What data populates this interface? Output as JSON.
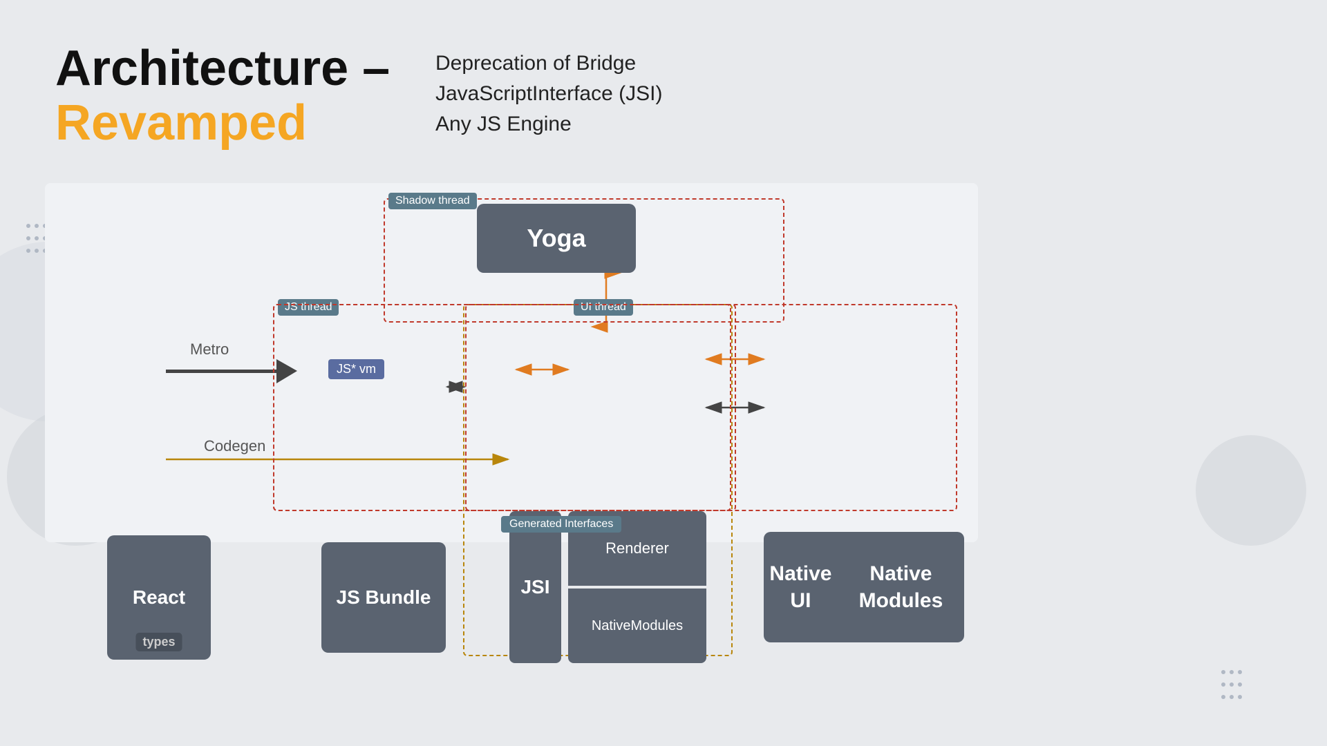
{
  "title": {
    "line1": "Architecture –",
    "line2": "Revamped"
  },
  "bullets": [
    "Deprecation of Bridge",
    "JavaScriptInterface (JSI)",
    "Any JS Engine"
  ],
  "diagram": {
    "shadow_thread": "Shadow thread",
    "js_thread": "JS thread",
    "ui_thread": "UI thread",
    "yoga": "Yoga",
    "react": "React",
    "types": "types",
    "metro": "Metro",
    "codegen": "Codegen",
    "js_bundle": "JS Bundle",
    "jsvm": "JS* vm",
    "jsi": "JSI",
    "renderer": "Renderer",
    "native_modules_inner": "NativeModules",
    "native_ui": "Native UI",
    "native_modules": "Native Modules",
    "generated_interfaces": "Generated Interfaces"
  }
}
